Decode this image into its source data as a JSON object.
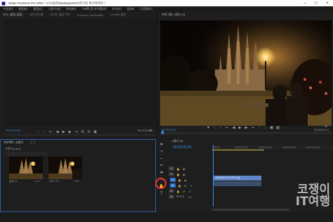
{
  "window": {
    "title": "Adobe Premiere Pro 2022 - C:\\사용자\\Desktop\\2021\\하기진 파크아카이 *",
    "controls": [
      "minimize-icon",
      "maximize-icon",
      "close-icon"
    ]
  },
  "menu": {
    "items": [
      "파일(F)",
      "편집(E)",
      "클립(C)",
      "시퀀스(S)",
      "마커(M)",
      "그래픽 및 타이틀(G)",
      "보기(V)",
      "창(W)",
      "도움말(H)"
    ]
  },
  "source_panel": {
    "tabs": [
      "소스: (클립 없음)",
      "효과 컨트롤",
      "오디오 클립 믹서",
      "Premiere Credentials",
      "Lumetri 범위"
    ],
    "timecode_left": "00;00;00;00",
    "timecode_right": "00;00;00;00"
  },
  "program_panel": {
    "tab": "프로그램: 시퀀스 01",
    "timecode_left": "00;00;00;00",
    "fit": "맞추기",
    "quality": "전체",
    "timecode_right": "00;00;01;14"
  },
  "project_panel": {
    "tabs": [
      "프로젝트: 코쟁이",
      "도구"
    ],
    "path": "코쟁이.prproj",
    "search_placeholder": "",
    "items": [
      {
        "name": "클립 01",
        "duration": "1;14"
      },
      {
        "name": "시퀀스 01",
        "duration": "1;14"
      }
    ]
  },
  "timeline": {
    "tab": "시퀀스 01",
    "timecode": "00;00;00;00",
    "ruler": [
      "00;00",
      "00;00;00;00",
      "00;00;00;00",
      "00;00;00;00",
      "00;00;00;00"
    ],
    "tracks": [
      {
        "name": "V3"
      },
      {
        "name": "V2"
      },
      {
        "name": "V1"
      },
      {
        "name": "A1"
      },
      {
        "name": "A2"
      },
      {
        "name": "A3"
      }
    ],
    "clip_label": "(MMDD0174.MP4 [V])",
    "master_label": "마스터",
    "master_value": "0.0"
  },
  "watermark": {
    "line1": "코쟁이",
    "line2": "IT여행"
  },
  "colors": {
    "accent": "#3a8be0",
    "clip_video": "#5f86c8",
    "highlight": "#e33333"
  }
}
